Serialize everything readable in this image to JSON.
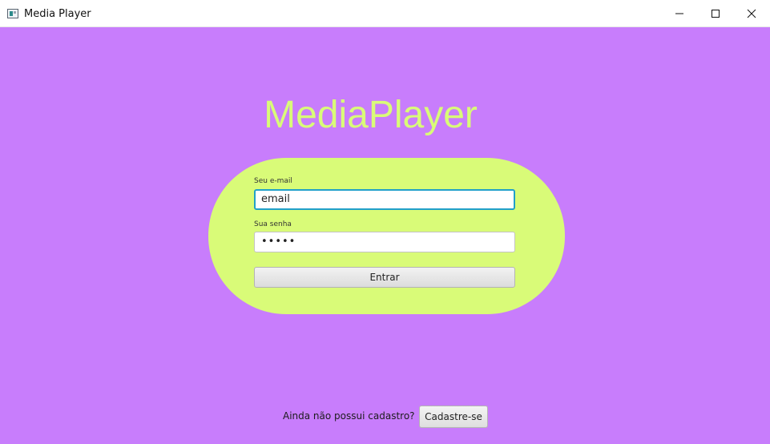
{
  "window": {
    "title": "Media Player",
    "icon": "app-window-icon",
    "controls": {
      "minimize_icon": "minimize-icon",
      "maximize_icon": "maximize-icon",
      "close_icon": "close-icon"
    }
  },
  "colors": {
    "background": "#c87dfc",
    "accent": "#d9fb78",
    "focus_border": "#21a0c9"
  },
  "app": {
    "title": "MediaPlayer"
  },
  "login": {
    "email_label": "Seu e-mail",
    "email_value": "email",
    "password_label": "Sua senha",
    "password_value": "•••••",
    "submit_label": "Entrar"
  },
  "signup": {
    "prompt": "Ainda não possui cadastro?",
    "button_label": "Cadastre-se"
  }
}
